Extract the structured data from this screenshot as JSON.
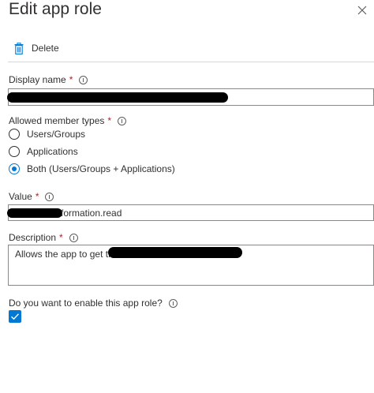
{
  "panel": {
    "title": "Edit app role"
  },
  "toolbar": {
    "delete_label": "Delete"
  },
  "display_name": {
    "label": "Display name",
    "required_marker": "*",
    "value": ""
  },
  "member_types": {
    "label": "Allowed member types",
    "required_marker": "*",
    "options": [
      {
        "label": "Users/Groups",
        "selected": false
      },
      {
        "label": "Applications",
        "selected": false
      },
      {
        "label": "Both (Users/Groups + Applications)",
        "selected": true
      }
    ]
  },
  "value_field": {
    "label": "Value",
    "required_marker": "*",
    "value_visible": "formation.read"
  },
  "description": {
    "label": "Description",
    "required_marker": "*",
    "value_visible": "Allows the app to get th"
  },
  "enable": {
    "label": "Do you want to enable this app role?",
    "checked": true
  },
  "colors": {
    "accent": "#0078d4",
    "required": "#a4262c",
    "text": "#323130",
    "border": "#8a8886"
  }
}
